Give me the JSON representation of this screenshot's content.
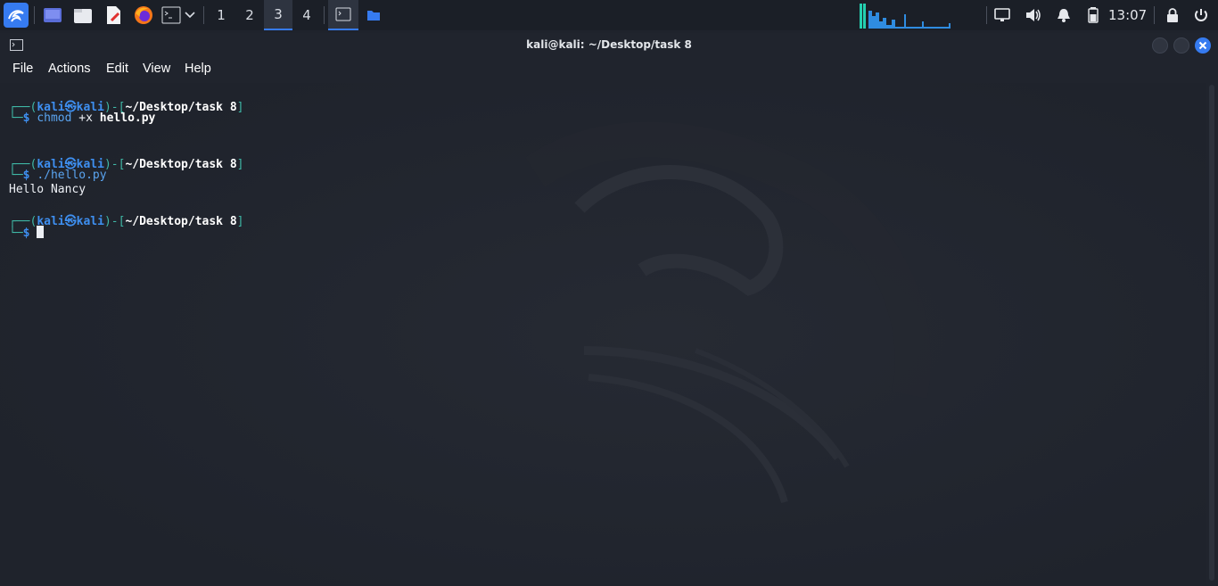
{
  "taskbar": {
    "workspaces": [
      "1",
      "2",
      "3",
      "4"
    ],
    "active_workspace": "3",
    "clock": "13:07",
    "accent": "#367bf0",
    "icons": {
      "menu": "kali-dragon-icon",
      "desktop": "show-desktop-icon",
      "files": "file-manager-icon",
      "editor": "text-editor-icon",
      "browser": "firefox-icon",
      "terminal": "terminal-icon",
      "network": "network-icon",
      "volume": "volume-icon",
      "notifications": "bell-icon",
      "battery": "battery-icon",
      "lock": "lock-icon",
      "logout": "power-icon"
    }
  },
  "window": {
    "title": "kali@kali: ~/Desktop/task 8"
  },
  "menubar": {
    "items": [
      "File",
      "Actions",
      "Edit",
      "View",
      "Help"
    ]
  },
  "terminal": {
    "prompts": [
      {
        "user": "kali",
        "host": "kali",
        "path": "~/Desktop/task 8",
        "command": "chmod",
        "args": " +x ",
        "arg_bold": "hello.py"
      },
      {
        "user": "kali",
        "host": "kali",
        "path": "~/Desktop/task 8",
        "command": "./hello.py",
        "args": "",
        "arg_bold": ""
      },
      {
        "user": "kali",
        "host": "kali",
        "path": "~/Desktop/task 8",
        "command": "",
        "args": "",
        "arg_bold": ""
      }
    ],
    "output": "Hello Nancy",
    "colors": {
      "prompt_blue": "#3e8ff0",
      "bracket_teal": "#3fb8a6",
      "background": "#1f232c"
    }
  }
}
